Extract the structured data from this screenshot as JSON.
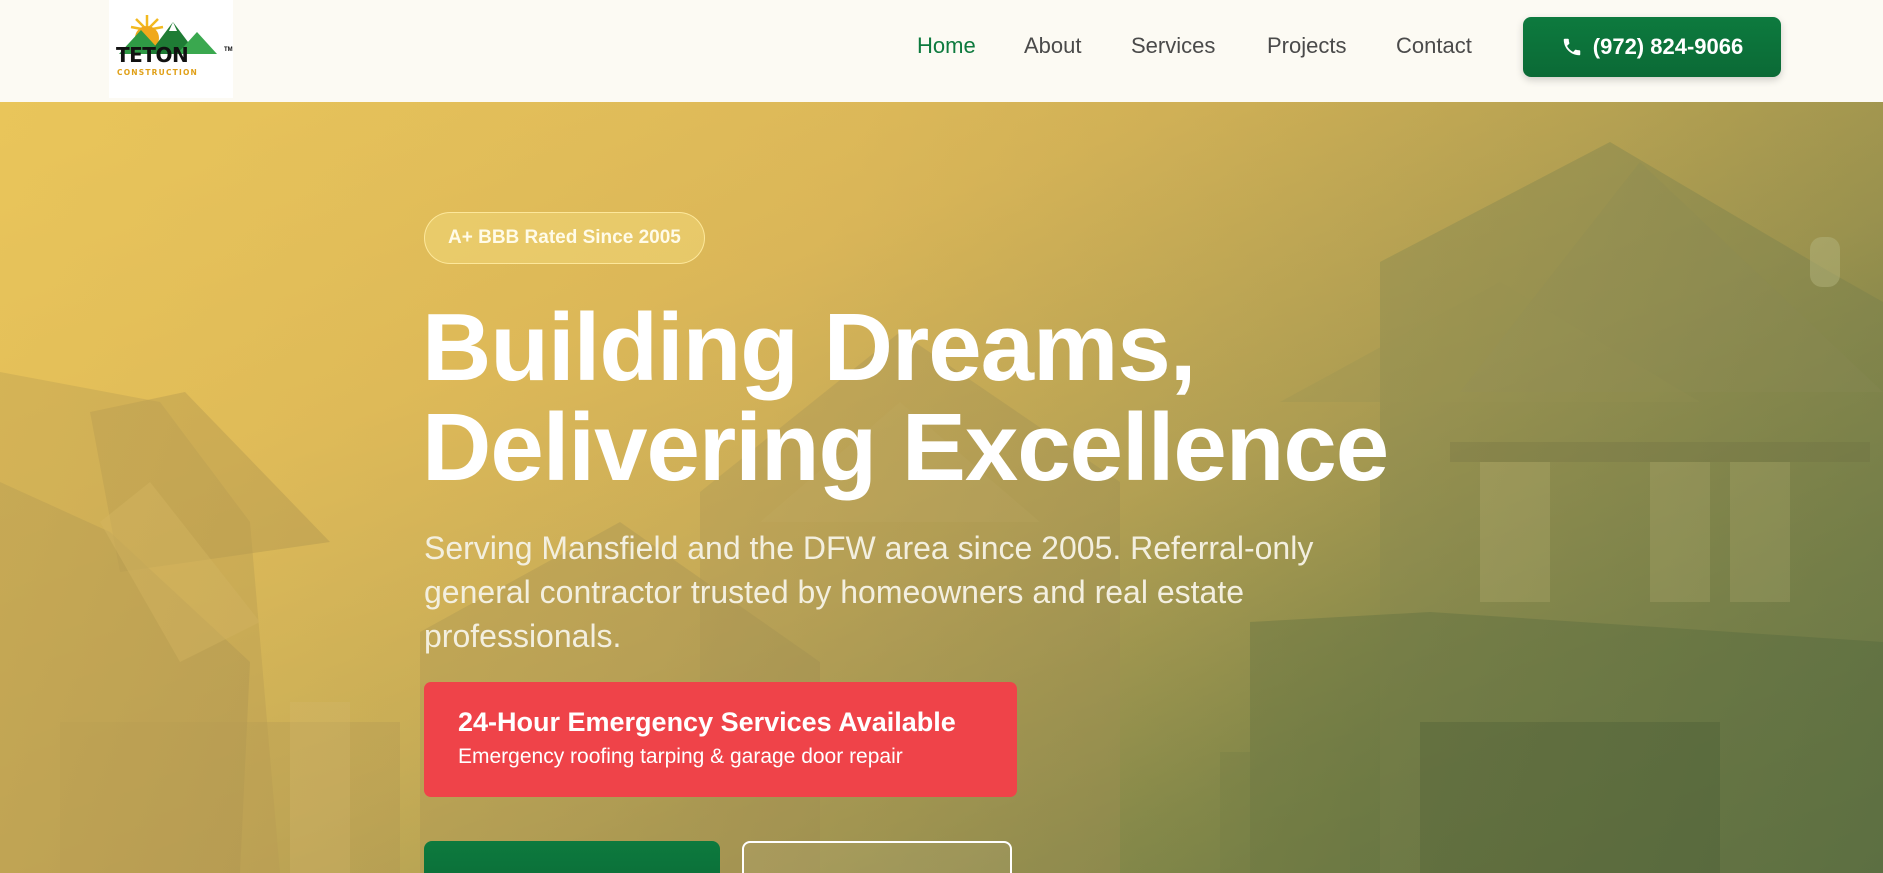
{
  "header": {
    "logo": {
      "wordmark": "TETON",
      "subline": "CONSTRUCTION",
      "trademark": "TM",
      "icon": "sun-mountains-logo"
    },
    "nav": [
      {
        "label": "Home",
        "active": true
      },
      {
        "label": "About",
        "active": false
      },
      {
        "label": "Services",
        "active": false
      },
      {
        "label": "Projects",
        "active": false
      },
      {
        "label": "Contact",
        "active": false
      }
    ],
    "phone_button": {
      "label": "(972) 824-9066",
      "icon": "phone-icon"
    }
  },
  "hero": {
    "badge": "A+ BBB Rated Since 2005",
    "title_line1": "Building Dreams,",
    "title_line2": "Delivering Excellence",
    "subtitle": "Serving Mansfield and the DFW area since 2005. Referral-only general contractor trusted by homeowners and real estate professionals.",
    "emergency": {
      "title": "24-Hour Emergency Services Available",
      "description": "Emergency roofing tarping & garage door repair"
    }
  },
  "colors": {
    "brand_green": "#0d7a3e",
    "emergency_red": "#ef4349",
    "hero_gold": "#e6c25a"
  }
}
